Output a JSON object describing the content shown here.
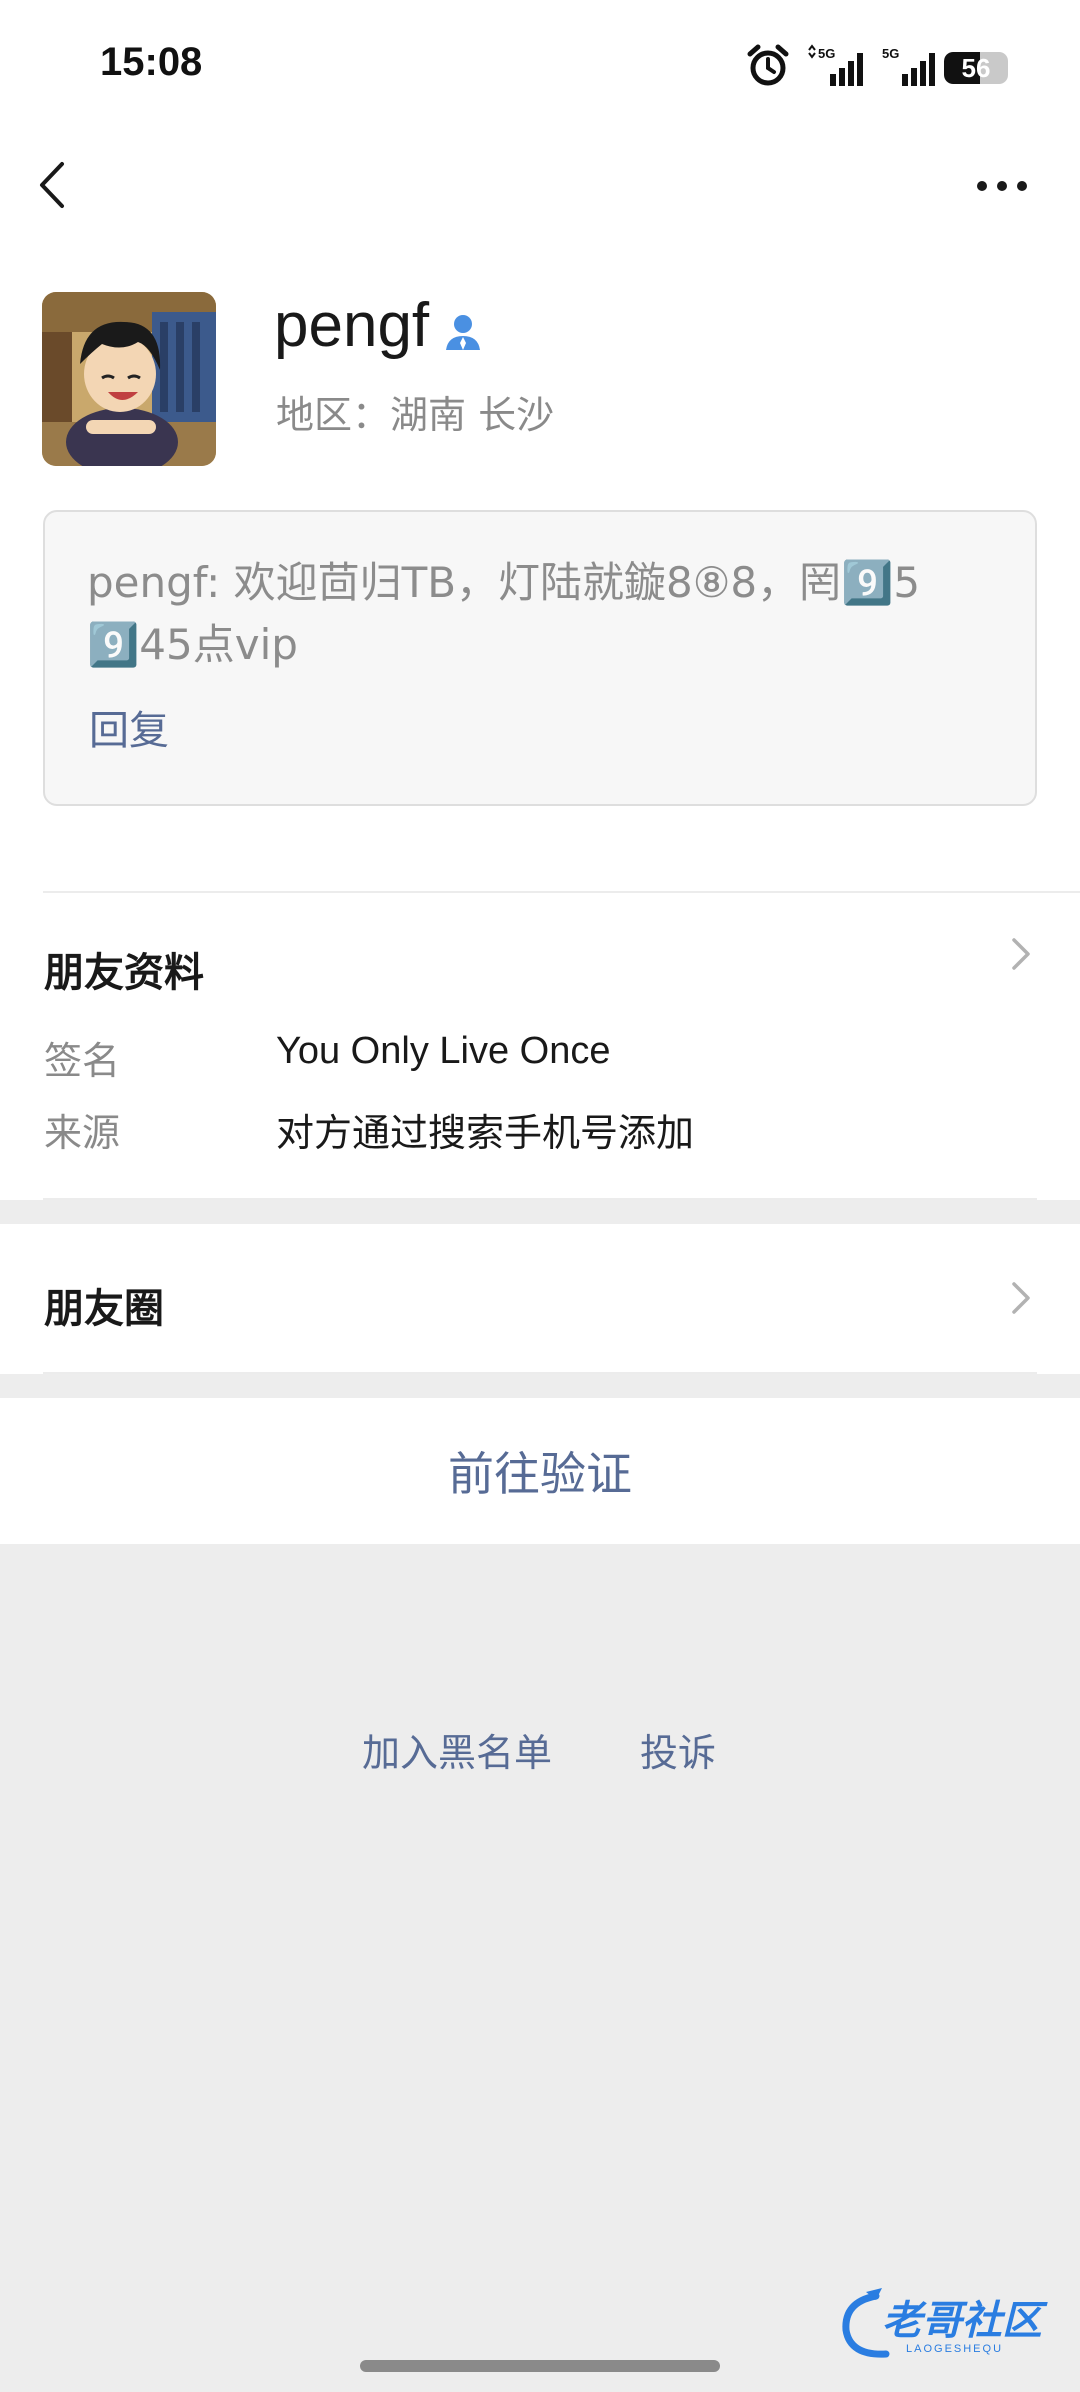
{
  "status_bar": {
    "time": "15:08",
    "battery": "56",
    "network_1": "5G",
    "network_2": "5G"
  },
  "profile": {
    "nickname": "pengf",
    "region": "地区：湖南  长沙"
  },
  "message": {
    "text": "pengf: 欢迎茴归TB，灯陆就鏇8⑧8，罔9️⃣5 9️⃣45点vip",
    "reply_label": "回复"
  },
  "friend_info": {
    "title": "朋友资料",
    "signature_label": "签名",
    "signature_value": "You Only Live Once",
    "source_label": "来源",
    "source_value": "对方通过搜索手机号添加"
  },
  "moments": {
    "title": "朋友圈"
  },
  "actions": {
    "verify_label": "前往验证",
    "blacklist_label": "加入黑名单",
    "report_label": "投诉"
  },
  "watermark": {
    "text": "老哥社区",
    "subtext": "LAOGESHEQU"
  },
  "colors": {
    "link": "#576b95",
    "background": "#ededed",
    "verified": "#4a90e2"
  }
}
